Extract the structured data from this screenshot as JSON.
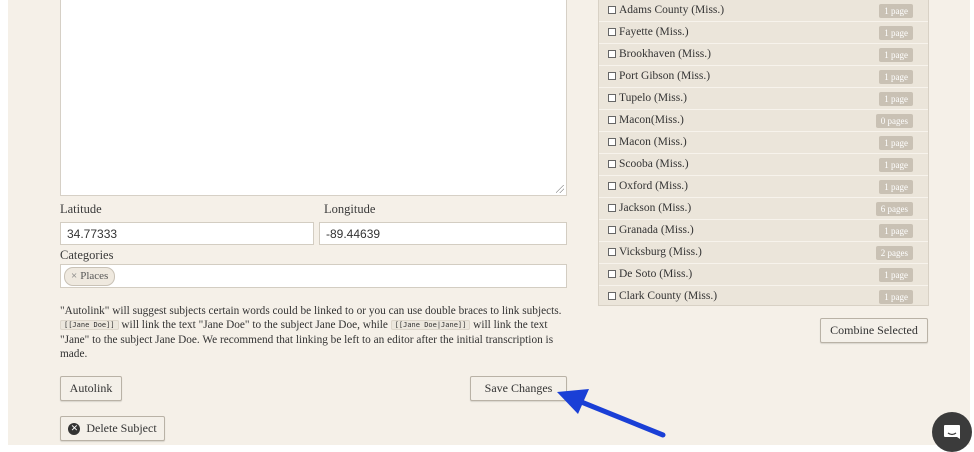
{
  "form": {
    "latitude_label": "Latitude",
    "longitude_label": "Longitude",
    "latitude_value": "34.77333",
    "longitude_value": "-89.44639",
    "categories_label": "Categories",
    "category_tag": "Places",
    "tag_remove_glyph": "×",
    "help_part1": "\"Autolink\" will suggest subjects certain words could be linked to or you can use double braces to link subjects. ",
    "code1": "[[Jane Doe]]",
    "help_part2": " will link the text \"Jane Doe\" to the subject Jane Doe, while ",
    "code2": "[[Jane Doe|Jane]]",
    "help_part3": " will link the text \"Jane\" to the subject Jane Doe. We recommend that linking be left to an editor after the initial transcription is made.",
    "autolink_label": "Autolink",
    "save_label": "Save Changes",
    "delete_label": "Delete Subject",
    "delete_icon_glyph": "✕"
  },
  "subjects": [
    {
      "name": "Adams County (Miss.)",
      "pages": "1 page"
    },
    {
      "name": "Fayette (Miss.)",
      "pages": "1 page"
    },
    {
      "name": "Brookhaven (Miss.)",
      "pages": "1 page"
    },
    {
      "name": "Port Gibson (Miss.)",
      "pages": "1 page"
    },
    {
      "name": "Tupelo (Miss.)",
      "pages": "1 page"
    },
    {
      "name": "Macon(Miss.)",
      "pages": "0 pages"
    },
    {
      "name": "Macon (Miss.)",
      "pages": "1 page"
    },
    {
      "name": "Scooba (Miss.)",
      "pages": "1 page"
    },
    {
      "name": "Oxford (Miss.)",
      "pages": "1 page"
    },
    {
      "name": "Jackson (Miss.)",
      "pages": "6 pages"
    },
    {
      "name": "Granada (Miss.)",
      "pages": "1 page"
    },
    {
      "name": "Vicksburg (Miss.)",
      "pages": "2 pages"
    },
    {
      "name": "De Soto (Miss.)",
      "pages": "1 page"
    },
    {
      "name": "Clark County (Miss.)",
      "pages": "1 page"
    }
  ],
  "combine_label": "Combine Selected",
  "colors": {
    "arrow": "#1a3fd6",
    "panel": "#f5f0e8",
    "badge": "#c9c1b4"
  },
  "icons": {
    "chat": "chat-bubble-icon",
    "delete": "close-circle-icon",
    "arrow": "annotation-arrow-icon"
  }
}
